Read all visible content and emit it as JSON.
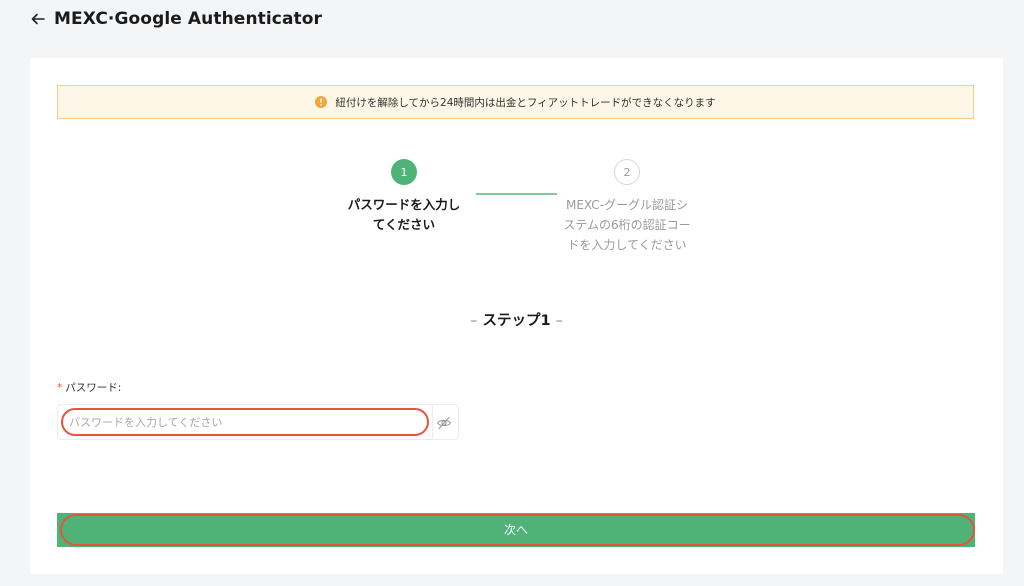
{
  "header": {
    "title": "MEXC·Google Authenticator"
  },
  "warning": {
    "text": "紐付けを解除してから24時間内は出金とフィアットトレードができなくなります"
  },
  "steps": [
    {
      "number": "1",
      "label": "パスワードを入力してください",
      "state": "active"
    },
    {
      "number": "2",
      "label": "MEXC-グーグル認証システムの6桁の認証コードを入力してください",
      "state": "pending"
    }
  ],
  "step_heading": {
    "dash_left": "–",
    "text": "ステップ1",
    "dash_right": "–"
  },
  "form": {
    "required_mark": "*",
    "password_label": "パスワード:",
    "password_placeholder": "パスワードを入力してください",
    "password_value": ""
  },
  "actions": {
    "next_label": "次へ"
  },
  "colors": {
    "accent": "#4fb377",
    "warning_bg": "#fef6e6",
    "warning_border": "#f7cc8b",
    "annotation": "#e4553d"
  },
  "icons": {
    "back": "arrow-left-icon",
    "warning": "info-circle-icon",
    "password_toggle": "eye-off-icon"
  }
}
